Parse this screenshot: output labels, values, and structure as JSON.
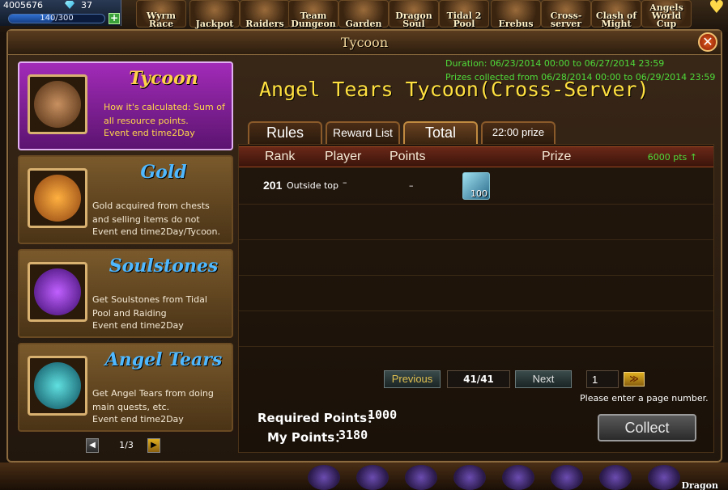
{
  "hud": {
    "gold": "4005676",
    "gems": "37",
    "energy": "140/300",
    "energy_level": 0.47,
    "plus": "+",
    "events": [
      {
        "label": "Wyrm Race"
      },
      {
        "label": "Jackpot"
      },
      {
        "label": "Raiders"
      },
      {
        "label": "Team Dungeon"
      },
      {
        "label": "Garden"
      },
      {
        "label": "Dragon Soul"
      },
      {
        "label": "Tidal 2 Pool"
      },
      {
        "label": "Erebus"
      },
      {
        "label": "Cross-server"
      },
      {
        "label": "Clash of Might"
      },
      {
        "label": "Angels World Cup"
      }
    ],
    "bottom_label": "Dragon"
  },
  "window": {
    "title": "Tycoon",
    "close_label": "✕"
  },
  "categories": [
    {
      "name": "Tycoon",
      "desc": "How it's calculated: Sum of all resource points.",
      "event_end": "Event end time2Day",
      "active": true,
      "icon": "tycoon-portrait-icon"
    },
    {
      "name": "Gold",
      "desc": "Gold acquired from chests and selling items do not",
      "event_end": "Event end time2Day/Tycoon.",
      "active": false,
      "icon": "gold-coin-icon"
    },
    {
      "name": "Soulstones",
      "desc": "Get Soulstones from Tidal Pool and Raiding",
      "event_end": "Event end time2Day",
      "active": false,
      "icon": "soulstone-orb-icon"
    },
    {
      "name": "Angel Tears",
      "desc": "Get Angel Tears from doing main quests, etc.",
      "event_end": "Event end time2Day",
      "active": false,
      "icon": "angel-tears-icon"
    }
  ],
  "category_pager": {
    "prev": "◀",
    "page": "1/3",
    "next": "▶"
  },
  "event": {
    "duration": "Duration: 06/23/2014 00:00 to 06/27/2014 23:59",
    "prizes_collected": "Prizes collected from 06/28/2014 00:00 to 06/29/2014 23:59",
    "title": "Angel Tears Tycoon(Cross-Server)"
  },
  "tabs": [
    {
      "label": "Rules",
      "active": false
    },
    {
      "label": "Reward List",
      "active": false
    },
    {
      "label": "Total",
      "active": true
    },
    {
      "label": "22:00 prize",
      "active": false
    }
  ],
  "table": {
    "headers": [
      "Rank",
      "Player",
      "Points",
      "Prize"
    ],
    "pts_hint": "6000 pts ↑",
    "rows": [
      {
        "rank": "201",
        "player": "Outside top",
        "dash1": "–",
        "points": "–",
        "prize_qty": "100"
      }
    ]
  },
  "pager": {
    "previous": "Previous",
    "info": "41/41",
    "next": "Next",
    "input_value": "1",
    "go": "≫",
    "hint": "Please enter a page number."
  },
  "footer": {
    "required_label": "Required Points：",
    "required_value": "1000",
    "my_label": "My Points：",
    "my_value": "3180",
    "collect": "Collect"
  }
}
